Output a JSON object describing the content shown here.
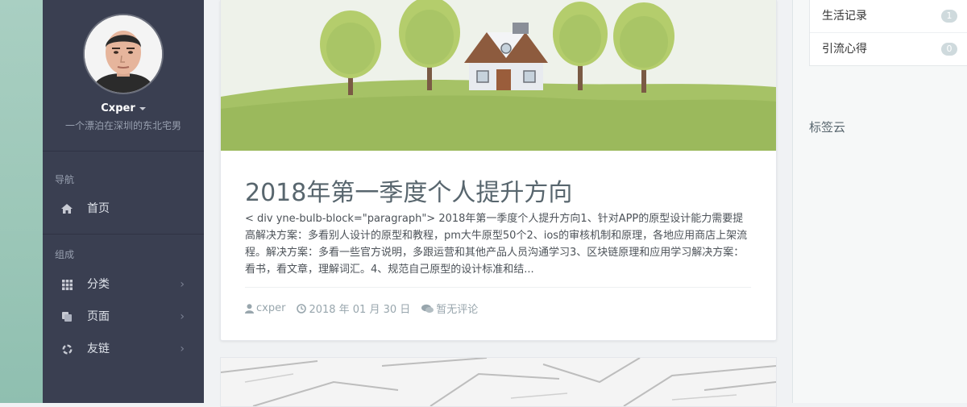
{
  "sidebar": {
    "profile": {
      "name": "Cxper",
      "bio": "一个漂泊在深圳的东北宅男"
    },
    "sections": [
      {
        "title": "导航",
        "items": [
          {
            "label": "首页",
            "icon": "home-icon"
          }
        ]
      },
      {
        "title": "组成",
        "items": [
          {
            "label": "分类",
            "icon": "grid-icon"
          },
          {
            "label": "页面",
            "icon": "copy-icon"
          },
          {
            "label": "友链",
            "icon": "spinner-icon"
          }
        ]
      }
    ]
  },
  "post": {
    "title": "2018年第一季度个人提升方向",
    "excerpt": "< div yne-bulb-block=\"paragraph\"> 2018年第一季度个人提升方向1、针对APP的原型设计能力需要提高解决方案：多看别人设计的原型和教程，pm大牛原型50个2、ios的审核机制和原理，各地应用商店上架流程。解决方案：多看一些官方说明，多跟运营和其他产品人员沟通学习3、区块链原理和应用学习解决方案：看书，看文章，理解词汇。4、规范自己原型的设计标准和结...",
    "author": "cxper",
    "date": "2018 年 01 月 30 日",
    "comments": "暂无评论"
  },
  "right_panel": {
    "categories": [
      {
        "label": "生活记录",
        "count": "1"
      },
      {
        "label": "引流心得",
        "count": "0"
      }
    ],
    "tag_cloud_title": "标签云"
  },
  "colors": {
    "sidebar_bg": "#3a3f51",
    "title_text": "#58666e",
    "meta_text": "#98a6ad",
    "badge_bg": "#cfdadd",
    "hero_grass": "#a6c266",
    "hero_sky": "#eef2ea"
  }
}
